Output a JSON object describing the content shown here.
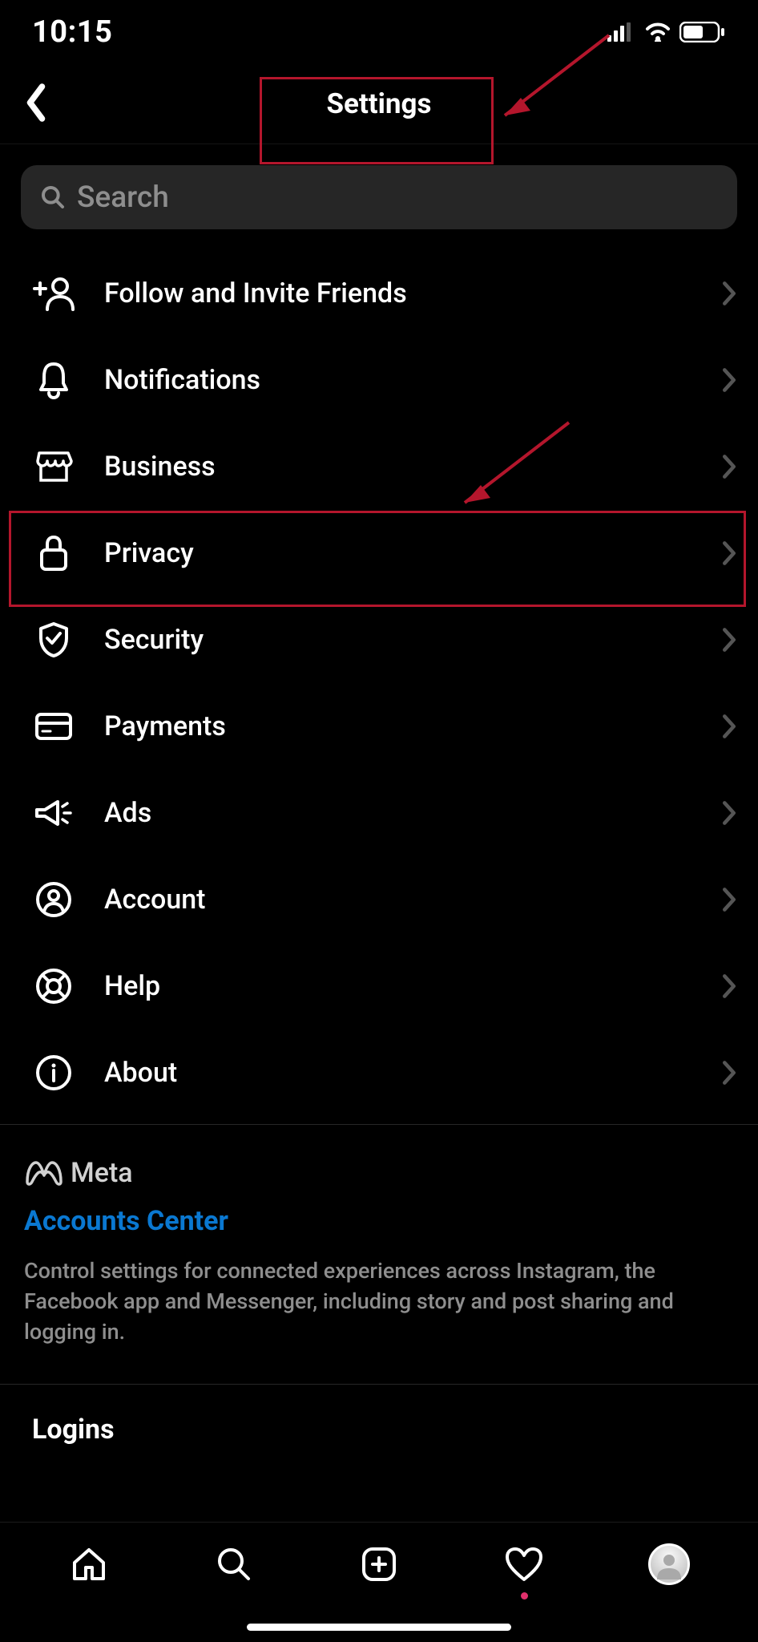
{
  "status": {
    "time": "10:15"
  },
  "header": {
    "title": "Settings"
  },
  "search": {
    "placeholder": "Search"
  },
  "menu": {
    "items": [
      {
        "label": "Follow and Invite Friends",
        "name": "item-follow-invite",
        "icon": "person-plus-icon"
      },
      {
        "label": "Notifications",
        "name": "item-notifications",
        "icon": "bell-icon"
      },
      {
        "label": "Business",
        "name": "item-business",
        "icon": "storefront-icon"
      },
      {
        "label": "Privacy",
        "name": "item-privacy",
        "icon": "lock-icon"
      },
      {
        "label": "Security",
        "name": "item-security",
        "icon": "shield-check-icon"
      },
      {
        "label": "Payments",
        "name": "item-payments",
        "icon": "card-icon"
      },
      {
        "label": "Ads",
        "name": "item-ads",
        "icon": "megaphone-icon"
      },
      {
        "label": "Account",
        "name": "item-account",
        "icon": "person-circle-icon"
      },
      {
        "label": "Help",
        "name": "item-help",
        "icon": "lifebuoy-icon"
      },
      {
        "label": "About",
        "name": "item-about",
        "icon": "info-icon"
      }
    ]
  },
  "meta": {
    "brand": "Meta",
    "link": "Accounts Center",
    "desc": "Control settings for connected experiences across Instagram, the Facebook app and Messenger, including story and post sharing and logging in."
  },
  "logins": {
    "title": "Logins"
  },
  "annotation": {
    "highlight_color": "#b4162c"
  }
}
